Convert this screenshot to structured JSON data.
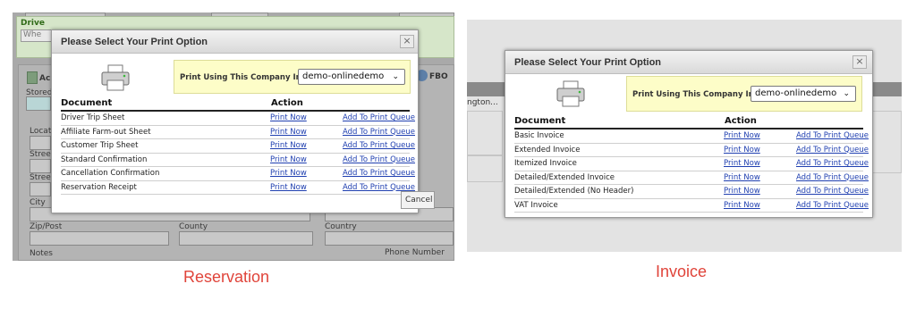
{
  "reservation_panel": {
    "background": {
      "driver_label": "Drive",
      "driver_input": "Whe",
      "stored_label": "Stored",
      "location_label": "Locat",
      "street_label_1": "Stree",
      "street_label_2": "Stree",
      "city_label": "City",
      "zip_label": "Zip/Post",
      "county_label": "County",
      "country_label": "Country",
      "notes_label": "Notes",
      "phone_label": "Phone Number",
      "ac_label": "Ac",
      "fbo_label": "FBO"
    },
    "dialog": {
      "title": "Please Select Your Print Option",
      "close_symbol": "×",
      "company_label": "Print Using This Company Info:",
      "company_value": "demo-onlinedemo",
      "chevron": "⌄",
      "col_document": "Document",
      "col_action": "Action",
      "rows": [
        {
          "doc": "Driver Trip Sheet",
          "print": "Print Now",
          "queue": "Add To Print Queue"
        },
        {
          "doc": "Affiliate Farm-out Sheet",
          "print": "Print Now",
          "queue": "Add To Print Queue"
        },
        {
          "doc": "Customer Trip Sheet",
          "print": "Print Now",
          "queue": "Add To Print Queue"
        },
        {
          "doc": "Standard Confirmation",
          "print": "Print Now",
          "queue": "Add To Print Queue"
        },
        {
          "doc": "Cancellation Confirmation",
          "print": "Print Now",
          "queue": "Add To Print Queue"
        },
        {
          "doc": "Reservation Receipt",
          "print": "Print Now",
          "queue": "Add To Print Queue"
        }
      ]
    },
    "caption": "Reservation"
  },
  "invoice_panel": {
    "background": {
      "partial_text": "ngton...",
      "cancel_label": "Cancel"
    },
    "dialog": {
      "title": "Please Select Your Print Option",
      "close_symbol": "×",
      "company_label": "Print Using This Company Info:",
      "company_value": "demo-onlinedemo",
      "chevron": "⌄",
      "col_document": "Document",
      "col_action": "Action",
      "rows": [
        {
          "doc": "Basic Invoice",
          "print": "Print Now",
          "queue": "Add To Print Queue"
        },
        {
          "doc": "Extended Invoice",
          "print": "Print Now",
          "queue": "Add To Print Queue"
        },
        {
          "doc": "Itemized Invoice",
          "print": "Print Now",
          "queue": "Add To Print Queue"
        },
        {
          "doc": "Detailed/Extended Invoice",
          "print": "Print Now",
          "queue": "Add To Print Queue"
        },
        {
          "doc": "Detailed/Extended (No Header)",
          "print": "Print Now",
          "queue": "Add To Print Queue"
        },
        {
          "doc": "VAT Invoice",
          "print": "Print Now",
          "queue": "Add To Print Queue"
        }
      ]
    },
    "caption": "Invoice"
  },
  "colors": {
    "link": "#1f3fb0",
    "company_box": "#fdfdc8",
    "caption": "#e0443a"
  },
  "icons": {
    "printer": "printer-icon",
    "close": "close-icon",
    "chevron": "chevron-down-icon"
  }
}
